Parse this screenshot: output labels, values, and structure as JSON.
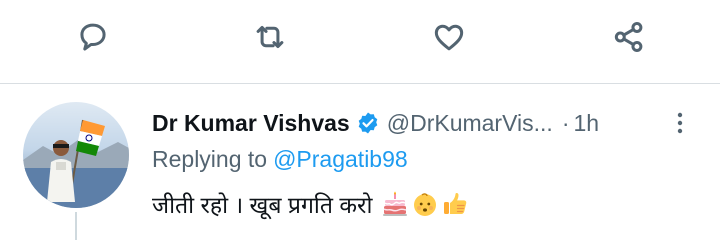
{
  "actions": {
    "reply": "reply-icon",
    "retweet": "retweet-icon",
    "like": "heart-icon",
    "share": "share-icon"
  },
  "reply_tweet": {
    "author_name": "Dr Kumar Vishvas",
    "handle": "@DrKumarVis...",
    "separator": "·",
    "time": "1h",
    "replying_label": "Replying to",
    "replying_to": "@Pragatib98",
    "text": "जीती रहो । खूब प्रगति करो",
    "emojis": [
      "birthday-cake",
      "baby-face",
      "thumbs-up"
    ]
  },
  "colors": {
    "accent": "#1d9bf0",
    "text_primary": "#0f1419",
    "text_secondary": "#536471",
    "divider": "#d9dee2"
  }
}
